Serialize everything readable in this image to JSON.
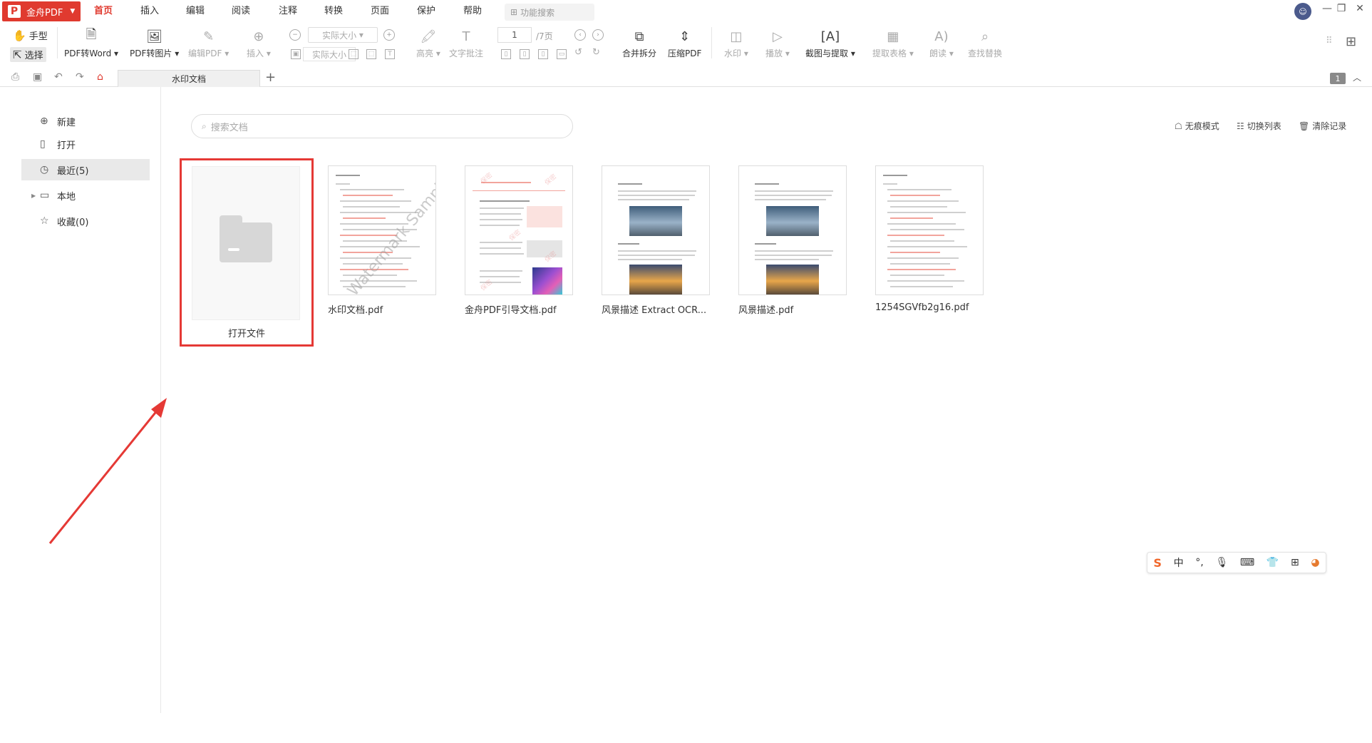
{
  "app": {
    "name": "金舟PDF",
    "logo": "P"
  },
  "menu": {
    "tabs": [
      "首页",
      "插入",
      "编辑",
      "阅读",
      "注释",
      "转换",
      "页面",
      "保护",
      "帮助"
    ],
    "func_search": "功能搜索"
  },
  "toolbar": {
    "hand": "手型",
    "select": "选择",
    "pdf_to_word": "PDF转Word",
    "pdf_to_image": "PDF转图片",
    "edit_pdf": "编辑PDF",
    "insert": "插入",
    "zoom_value": "实际大小",
    "zoom_actual": "实际大小",
    "highlight": "高亮",
    "text_note": "文字批注",
    "page_value": "1",
    "page_total": "/7页",
    "merge_split": "合并拆分",
    "compress": "压缩PDF",
    "watermark": "水印",
    "play": "播放",
    "screenshot_extract": "截图与提取",
    "extract_table": "提取表格",
    "read_aloud": "朗读",
    "find_replace": "查找替换"
  },
  "tabbar": {
    "doc_tab": "水印文档",
    "add": "+",
    "page_badge": "1"
  },
  "sidebar": {
    "new": "新建",
    "open": "打开",
    "recent": "最近(5)",
    "local": "本地",
    "favorites": "收藏(0)"
  },
  "main": {
    "search_placeholder": "搜索文档",
    "actions": {
      "no_trace": "无痕模式",
      "switch_list": "切换列表",
      "clear": "清除记录"
    },
    "open_file_label": "打开文件",
    "files": [
      "水印文档.pdf",
      "金舟PDF引导文档.pdf",
      "风景描述 Extract OCR...",
      "风景描述.pdf",
      "1254SGVfb2g16.pdf"
    ],
    "watermark_text": "Watermark Sample"
  },
  "ime": {
    "logo": "S",
    "lang": "中"
  },
  "colors": {
    "accent": "#e03a2f",
    "highlight_box": "#e53935",
    "arrow": "#e53935"
  }
}
